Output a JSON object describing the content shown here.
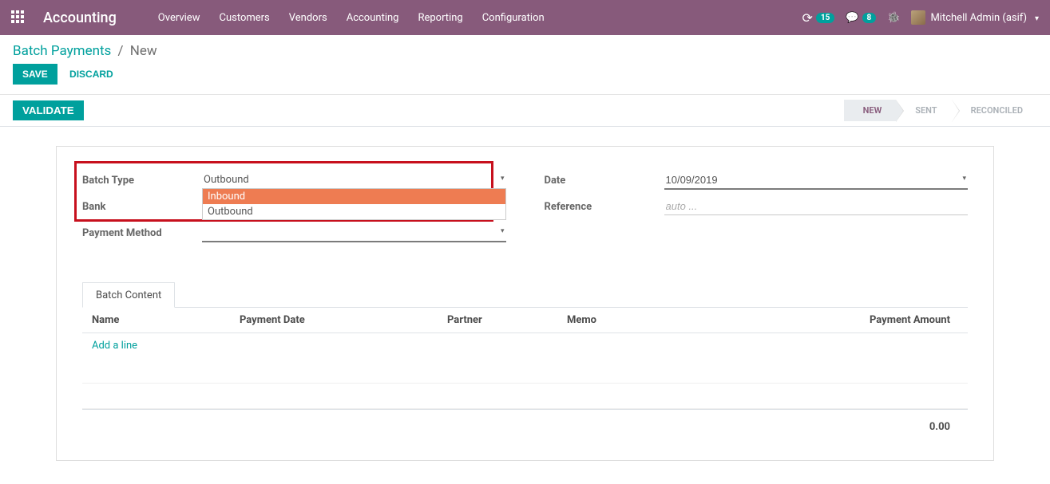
{
  "app": {
    "name": "Accounting"
  },
  "nav": [
    "Overview",
    "Customers",
    "Vendors",
    "Accounting",
    "Reporting",
    "Configuration"
  ],
  "systray": {
    "timer_badge": "15",
    "chat_badge": "8",
    "user": "Mitchell Admin (asif)"
  },
  "breadcrumb": {
    "root": "Batch Payments",
    "current": "New"
  },
  "buttons": {
    "save": "SAVE",
    "discard": "DISCARD",
    "validate": "VALIDATE"
  },
  "status": {
    "steps": [
      "NEW",
      "SENT",
      "RECONCILED"
    ],
    "active": 0
  },
  "form": {
    "labels": {
      "batch_type": "Batch Type",
      "bank": "Bank",
      "payment_method": "Payment Method",
      "date": "Date",
      "reference": "Reference"
    },
    "batch_type_value": "Outbound",
    "batch_type_options": [
      "Inbound",
      "Outbound"
    ],
    "date_value": "10/09/2019",
    "reference_placeholder": "auto ..."
  },
  "tab": {
    "label": "Batch Content"
  },
  "table": {
    "cols": {
      "name": "Name",
      "pdate": "Payment Date",
      "partner": "Partner",
      "memo": "Memo",
      "amount": "Payment Amount"
    },
    "add_line": "Add a line",
    "total": "0.00"
  }
}
